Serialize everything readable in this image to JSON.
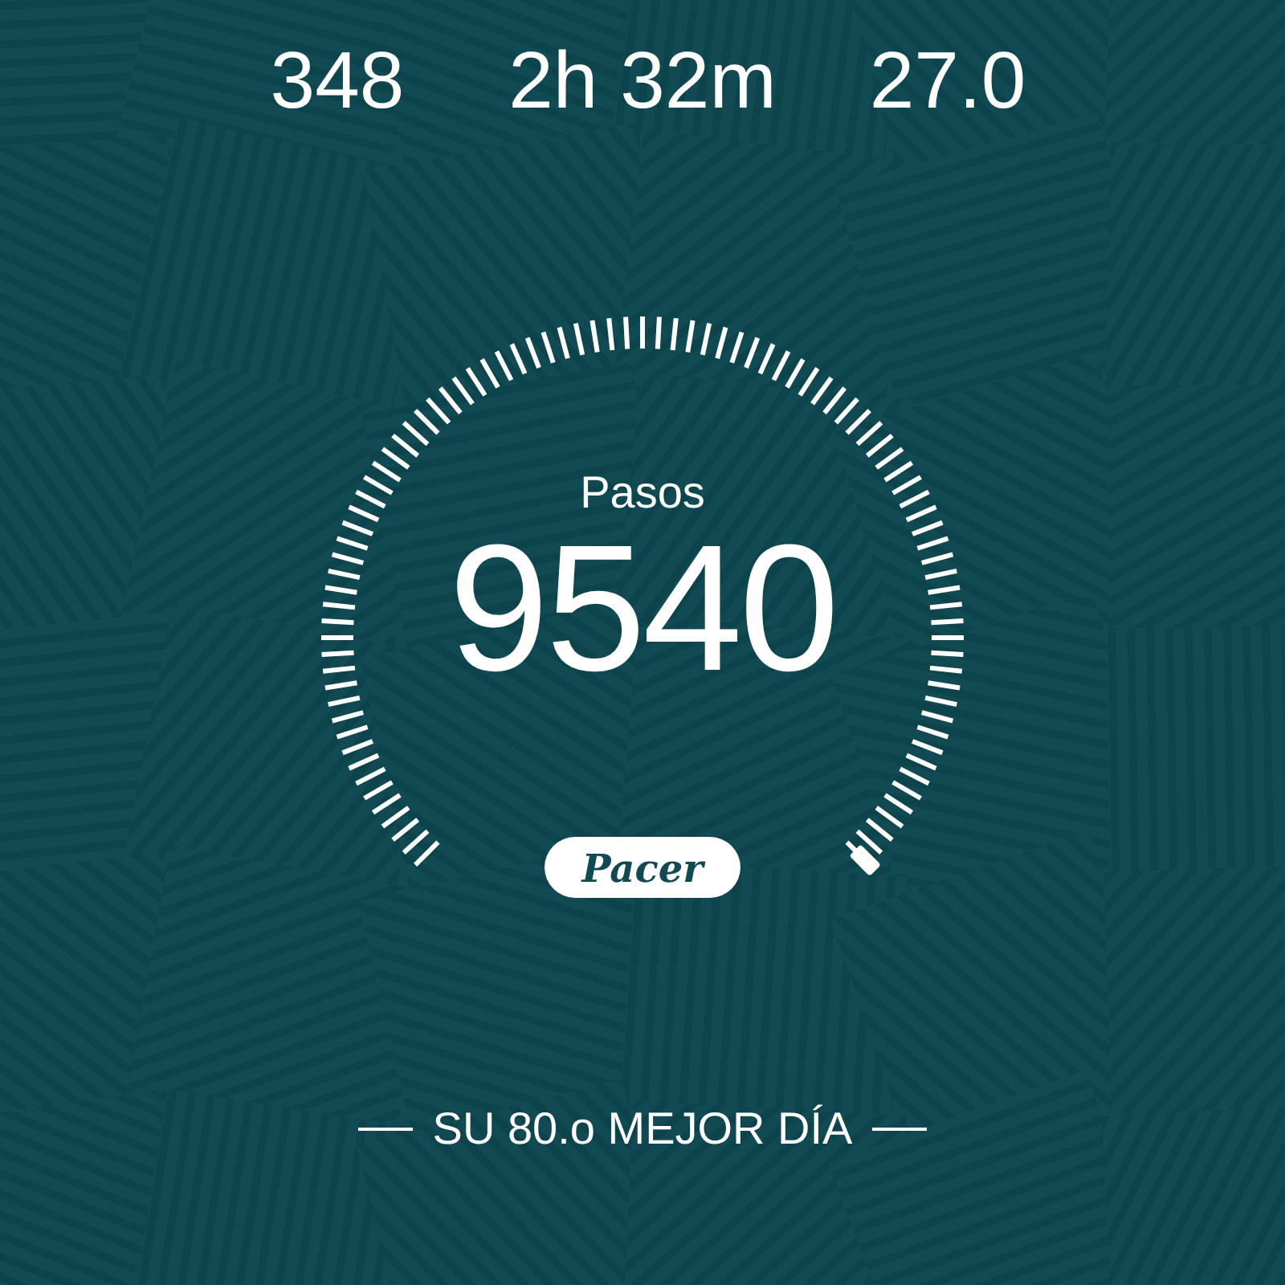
{
  "stats": [
    {
      "value": "348"
    },
    {
      "value": "2h 32m"
    },
    {
      "value": "27.0"
    }
  ],
  "steps": {
    "label": "Pasos",
    "value": "9540"
  },
  "brand": {
    "text": "Pacer"
  },
  "best_day": {
    "text": "SU 80.o MEJOR DÍA"
  }
}
